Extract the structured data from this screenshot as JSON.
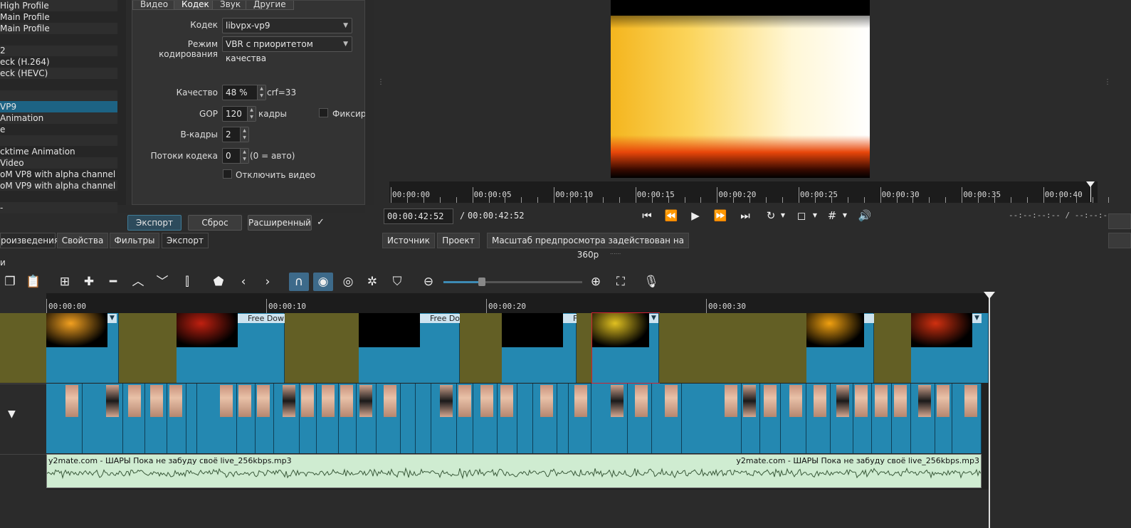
{
  "presets": [
    {
      "label": "High Profile",
      "style": ""
    },
    {
      "label": "Main Profile",
      "style": "alt"
    },
    {
      "label": "Main Profile",
      "style": ""
    },
    {
      "label": "",
      "style": "alt"
    },
    {
      "label": "2",
      "style": ""
    },
    {
      "label": "eck (H.264)",
      "style": "alt"
    },
    {
      "label": "eck (HEVC)",
      "style": ""
    },
    {
      "label": "",
      "style": "alt"
    },
    {
      "label": "",
      "style": ""
    },
    {
      "label": "VP9",
      "style": "sel"
    },
    {
      "label": "Animation",
      "style": ""
    },
    {
      "label": "e",
      "style": "alt"
    },
    {
      "label": "",
      "style": ""
    },
    {
      "label": "cktime Animation",
      "style": "alt"
    },
    {
      "label": "Video",
      "style": ""
    },
    {
      "label": "oM VP8 with alpha channel",
      "style": "alt"
    },
    {
      "label": "oM VP9 with alpha channel",
      "style": ""
    },
    {
      "label": "",
      "style": "alt"
    },
    {
      "label": "-",
      "style": ""
    }
  ],
  "settings": {
    "tabs": [
      "Видео",
      "Кодек",
      "Звук",
      "Другие"
    ],
    "codec_label": "Кодек",
    "codec_value": "libvpx-vp9",
    "mode_label": "Режим кодирования",
    "mode_value": "VBR с приоритетом качества",
    "quality_label": "Качество",
    "quality_value": "48 %",
    "quality_suffix": "crf=33",
    "gop_label": "GOP",
    "gop_value": "120",
    "gop_suffix": "кадры",
    "fixed_label": "Фиксиро",
    "bframes_label": "B-кадры",
    "bframes_value": "2",
    "threads_label": "Потоки кодека",
    "threads_value": "0",
    "threads_suffix": "(0 = авто)",
    "disable_video_label": "Отключить видео"
  },
  "export_buttons": {
    "export": "Экспорт",
    "reset": "Сброс",
    "advanced": "Расширенный",
    "check": "✓"
  },
  "left_tabs": [
    "роизведения",
    "Свойства",
    "Фильтры",
    "Экспорт"
  ],
  "menu_fragment": "и",
  "player": {
    "ruler_labels": [
      "00:00:00",
      "00:00:05",
      "00:00:10",
      "00:00:15",
      "00:00:20",
      "00:00:25",
      "00:00:30",
      "00:00:35",
      "00:00:40"
    ],
    "current_time": "00:00:42:52",
    "separator": "/",
    "total_time": "00:00:42:52",
    "in_out": "--:--:--:--  /  --:--:--:--",
    "tabs": {
      "source": "Источник",
      "project": "Проект"
    },
    "scale_notice": "Масштаб предпросмотра задействован на 360p",
    "splitter_dots": "......"
  },
  "timeline": {
    "ruler_labels": [
      "00:00:00",
      "00:00:10",
      "00:00:20",
      "00:00:30"
    ],
    "clip_tags": [
      "Free Down",
      "Free Do",
      "F",
      "F"
    ],
    "audio_label": "y2mate.com - ШАРЫ  Пока не забуду своё live_256kbps.mp3",
    "audio_label_end": "y2mate.com - ШАРЫ  Пока не забуду своё live_256kbps.mp3"
  },
  "icons": {
    "filter": "▼",
    "play": "▶",
    "skip_back": "⏮",
    "rewind": "⏪",
    "fast_forward": "⏩",
    "skip_forward": "⏭"
  },
  "colors": {
    "selection": "#1d6384",
    "clip": "#2488b1",
    "gap": "#635f25",
    "audio": "#cfecd1"
  }
}
